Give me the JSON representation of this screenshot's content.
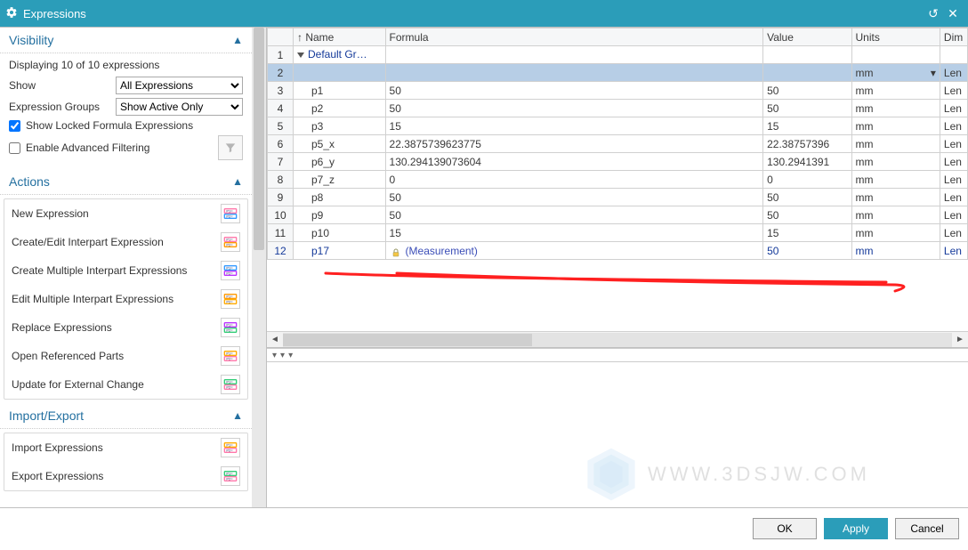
{
  "title": "Expressions",
  "left": {
    "visibility": {
      "title": "Visibility",
      "summary": "Displaying 10 of 10 expressions",
      "show_label": "Show",
      "show_value": "All Expressions",
      "groups_label": "Expression Groups",
      "groups_value": "Show Active Only",
      "locked_label": "Show Locked Formula Expressions",
      "adv_label": "Enable Advanced Filtering"
    },
    "actions": {
      "title": "Actions",
      "items": [
        "New Expression",
        "Create/Edit Interpart Expression",
        "Create Multiple Interpart Expressions",
        "Edit Multiple Interpart Expressions",
        "Replace Expressions",
        "Open Referenced Parts",
        "Update for External Change"
      ]
    },
    "importexport": {
      "title": "Import/Export",
      "items": [
        "Import Expressions",
        "Export Expressions"
      ]
    }
  },
  "grid": {
    "headers": {
      "name": "Name",
      "formula": "Formula",
      "value": "Value",
      "units": "Units",
      "dim": "Dim"
    },
    "group_label": "Default Gr…",
    "rows": [
      {
        "n": 3,
        "name": "p1",
        "formula": "50",
        "value": "50",
        "units": "mm",
        "dim": "Len"
      },
      {
        "n": 4,
        "name": "p2",
        "formula": "50",
        "value": "50",
        "units": "mm",
        "dim": "Len"
      },
      {
        "n": 5,
        "name": "p3",
        "formula": "15",
        "value": "15",
        "units": "mm",
        "dim": "Len"
      },
      {
        "n": 6,
        "name": "p5_x",
        "formula": "22.3875739623775",
        "value": "22.38757396",
        "units": "mm",
        "dim": "Len"
      },
      {
        "n": 7,
        "name": "p6_y",
        "formula": "130.294139073604",
        "value": "130.2941391",
        "units": "mm",
        "dim": "Len"
      },
      {
        "n": 8,
        "name": "p7_z",
        "formula": "0",
        "value": "0",
        "units": "mm",
        "dim": "Len"
      },
      {
        "n": 9,
        "name": "p8",
        "formula": "50",
        "value": "50",
        "units": "mm",
        "dim": "Len"
      },
      {
        "n": 10,
        "name": "p9",
        "formula": "50",
        "value": "50",
        "units": "mm",
        "dim": "Len"
      },
      {
        "n": 11,
        "name": "p10",
        "formula": "15",
        "value": "15",
        "units": "mm",
        "dim": "Len"
      },
      {
        "n": 12,
        "name": "p17",
        "formula": "(Measurement)",
        "value": "50",
        "units": "mm",
        "dim": "Len",
        "meas": true
      }
    ],
    "selected_units": "mm",
    "selected_dim": "Len"
  },
  "footer": {
    "ok": "OK",
    "apply": "Apply",
    "cancel": "Cancel"
  },
  "watermark": "WWW.3DSJW.COM"
}
